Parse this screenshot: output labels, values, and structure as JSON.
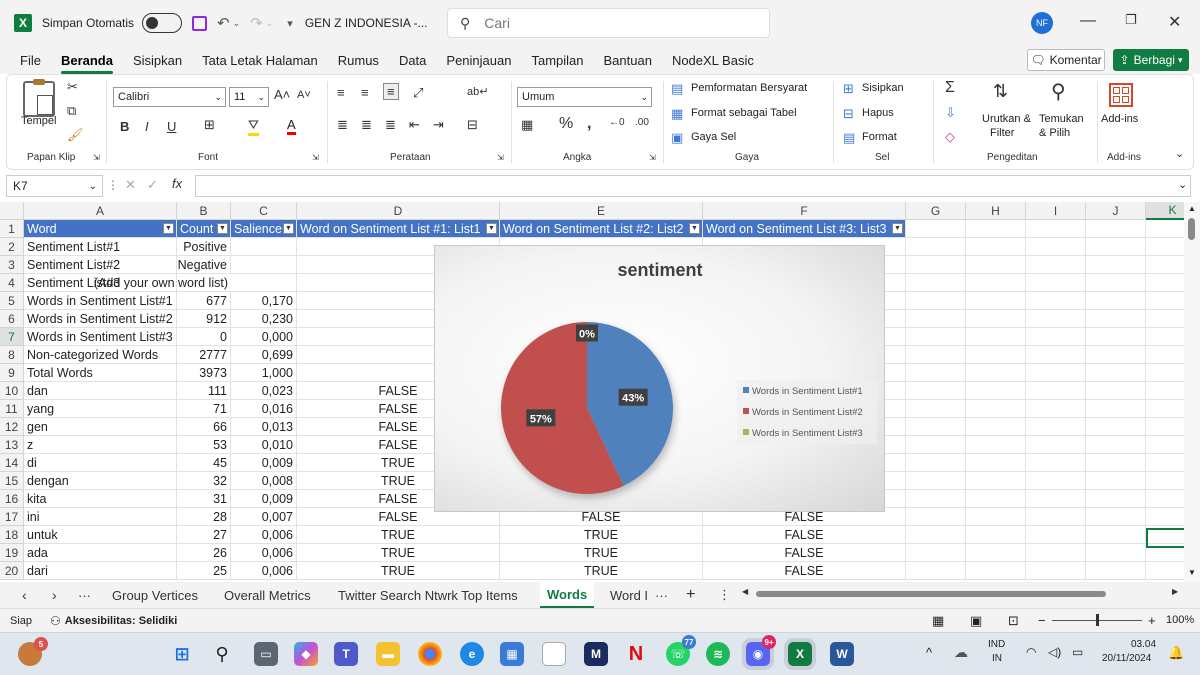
{
  "titlebar": {
    "autosave_label": "Simpan Otomatis",
    "doc_title": "GEN Z INDONESIA  -...",
    "search_placeholder": "Cari",
    "avatar_initials": "NF"
  },
  "menu": {
    "items": [
      "File",
      "Beranda",
      "Sisipkan",
      "Tata Letak Halaman",
      "Rumus",
      "Data",
      "Peninjauan",
      "Tampilan",
      "Bantuan",
      "NodeXL Basic"
    ],
    "active": "Beranda",
    "comment_label": "Komentar",
    "share_label": "Berbagi"
  },
  "ribbon": {
    "groups": {
      "clipboard": "Papan Klip",
      "font": "Font",
      "alignment": "Perataan",
      "number": "Angka",
      "styles": "Gaya",
      "cells": "Sel",
      "editing": "Pengeditan",
      "addins": "Add-ins"
    },
    "paste_label": "Tempel",
    "font_name": "Calibri",
    "font_size": "11",
    "number_format": "Umum",
    "conditional_format": "Pemformatan Bersyarat",
    "format_as_table": "Format sebagai Tabel",
    "cell_styles": "Gaya Sel",
    "insert": "Sisipkan",
    "delete": "Hapus",
    "format": "Format",
    "sort_filter_1": "Urutkan &",
    "sort_filter_2": "Filter",
    "find_select_1": "Temukan",
    "find_select_2": "& Pilih",
    "addins_label": "Add-ins"
  },
  "formula_bar": {
    "name_box": "K7",
    "fx": "fx",
    "content": ""
  },
  "columns": [
    "A",
    "B",
    "C",
    "D",
    "E",
    "F",
    "G",
    "H",
    "I",
    "J",
    "K"
  ],
  "header_row": [
    "Word",
    "Count",
    "Salience",
    "Word on Sentiment List #1: List1",
    "Word on Sentiment List #2: List2",
    "Word on Sentiment List #3: List3"
  ],
  "rows": [
    {
      "n": "2",
      "a": "Sentiment List#1",
      "b": "Positive",
      "c": "",
      "d": "",
      "e": "",
      "f": ""
    },
    {
      "n": "3",
      "a": "Sentiment List#2",
      "b": "Negative",
      "c": "",
      "d": "",
      "e": "",
      "f": ""
    },
    {
      "n": "4",
      "a": "Sentiment List#3",
      "b": "(Add your own word list)",
      "c": "",
      "d": "",
      "e": "",
      "f": ""
    },
    {
      "n": "5",
      "a": "Words in Sentiment List#1",
      "b": "677",
      "c": "0,170",
      "d": "",
      "e": "",
      "f": ""
    },
    {
      "n": "6",
      "a": "Words in Sentiment List#2",
      "b": "912",
      "c": "0,230",
      "d": "",
      "e": "",
      "f": ""
    },
    {
      "n": "7",
      "a": "Words in Sentiment List#3",
      "b": "0",
      "c": "0,000",
      "d": "",
      "e": "",
      "f": ""
    },
    {
      "n": "8",
      "a": "Non-categorized Words",
      "b": "2777",
      "c": "0,699",
      "d": "",
      "e": "",
      "f": ""
    },
    {
      "n": "9",
      "a": "Total Words",
      "b": "3973",
      "c": "1,000",
      "d": "",
      "e": "",
      "f": ""
    },
    {
      "n": "10",
      "a": "dan",
      "b": "111",
      "c": "0,023",
      "d": "FALSE",
      "e": "",
      "f": ""
    },
    {
      "n": "11",
      "a": "yang",
      "b": "71",
      "c": "0,016",
      "d": "FALSE",
      "e": "",
      "f": ""
    },
    {
      "n": "12",
      "a": "gen",
      "b": "66",
      "c": "0,013",
      "d": "FALSE",
      "e": "",
      "f": ""
    },
    {
      "n": "13",
      "a": "z",
      "b": "53",
      "c": "0,010",
      "d": "FALSE",
      "e": "",
      "f": ""
    },
    {
      "n": "14",
      "a": "di",
      "b": "45",
      "c": "0,009",
      "d": "TRUE",
      "e": "",
      "f": ""
    },
    {
      "n": "15",
      "a": "dengan",
      "b": "32",
      "c": "0,008",
      "d": "TRUE",
      "e": "",
      "f": ""
    },
    {
      "n": "16",
      "a": "kita",
      "b": "31",
      "c": "0,009",
      "d": "FALSE",
      "e": "",
      "f": ""
    },
    {
      "n": "17",
      "a": "ini",
      "b": "28",
      "c": "0,007",
      "d": "FALSE",
      "e": "FALSE",
      "f": "FALSE"
    },
    {
      "n": "18",
      "a": "untuk",
      "b": "27",
      "c": "0,006",
      "d": "TRUE",
      "e": "TRUE",
      "f": "FALSE"
    },
    {
      "n": "19",
      "a": "ada",
      "b": "26",
      "c": "0,006",
      "d": "TRUE",
      "e": "TRUE",
      "f": "FALSE"
    },
    {
      "n": "20",
      "a": "dari",
      "b": "25",
      "c": "0,006",
      "d": "TRUE",
      "e": "TRUE",
      "f": "FALSE"
    }
  ],
  "chart_data": {
    "type": "pie",
    "title": "sentiment",
    "categories": [
      "Words in Sentiment List#1",
      "Words in Sentiment List#2",
      "Words in Sentiment List#3"
    ],
    "values": [
      43,
      57,
      0
    ],
    "labels": [
      "43%",
      "57%",
      "0%"
    ],
    "colors": [
      "#4f81bd",
      "#c0504d",
      "#9bbb59"
    ],
    "legend": "right"
  },
  "sheets": {
    "tabs": [
      "Group Vertices",
      "Overall Metrics",
      "Twitter Search Ntwrk Top Items",
      "Words",
      "Word I"
    ],
    "active": "Words"
  },
  "status": {
    "ready": "Siap",
    "accessibility": "Aksesibilitas: Selidiki",
    "zoom": "100%"
  },
  "taskbar": {
    "weather_badge": "5",
    "whatsapp_badge": "77",
    "discord_badge": "9+",
    "lang_1": "IND",
    "lang_2": "IN",
    "time": "03.04",
    "date": "20/11/2024"
  }
}
